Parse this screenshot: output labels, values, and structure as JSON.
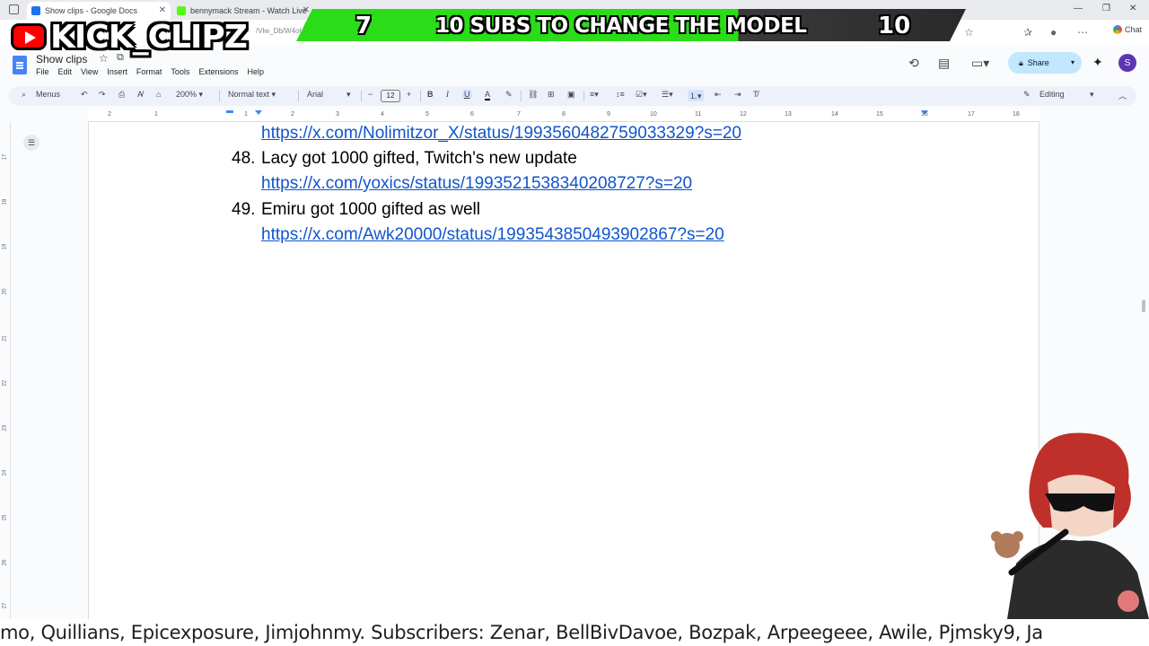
{
  "browser": {
    "tabs": [
      {
        "label": "Show clips - Google Docs",
        "active": true
      },
      {
        "label": "bennymack Stream - Watch Live",
        "active": false
      }
    ],
    "url_fragment": "/Vlw_Db/W4oU",
    "chat_label": "Chat"
  },
  "overlay": {
    "brand": "KICK_CLIPZ",
    "sub_goal": {
      "current": "7",
      "text": "10 SUBS TO CHANGE THE MODEL",
      "target": "10",
      "progress": 0.7
    }
  },
  "docs": {
    "title": "Show clips",
    "menu": [
      "File",
      "Edit",
      "View",
      "Insert",
      "Format",
      "Tools",
      "Extensions",
      "Help"
    ],
    "share_label": "Share",
    "avatar_initial": "S",
    "toolbar": {
      "menus_label": "Menus",
      "zoom": "200%",
      "style": "Normal text",
      "font": "Arial",
      "font_size": "12",
      "mode": "Editing"
    },
    "ruler_numbers": [
      "2",
      "1",
      "1",
      "2",
      "3",
      "4",
      "5",
      "6",
      "7",
      "8",
      "9",
      "10",
      "11",
      "12",
      "13",
      "14",
      "15",
      "16",
      "17",
      "18"
    ],
    "vruler_numbers": [
      "17",
      "18",
      "19",
      "20",
      "21",
      "22",
      "23",
      "24",
      "25",
      "26",
      "27"
    ]
  },
  "content": {
    "partial_link": "https://x.com/Nolimitzor_X/status/1993560482759033329?s=20",
    "entries": [
      {
        "num": "48.",
        "text": "Lacy got 1000 gifted, Twitch's new update",
        "link": "https://x.com/yoxics/status/1993521538340208727?s=20"
      },
      {
        "num": "49.",
        "text": "Emiru got 1000 gifted as well",
        "link": "https://x.com/Awk20000/status/1993543850493902867?s=20"
      }
    ]
  },
  "ticker": {
    "text": "mo, Quillians, Epicexposure, Jimjohnmy.  Subscribers: Zenar, BellBivDavoe, Bozpak, Arpeegeee, Awile, Pjmsky9, Ja"
  },
  "colors": {
    "link": "#1155cc",
    "share_bg": "#c2e7ff",
    "goal_green": "#2bdc19",
    "yt_red": "#ff0000"
  }
}
